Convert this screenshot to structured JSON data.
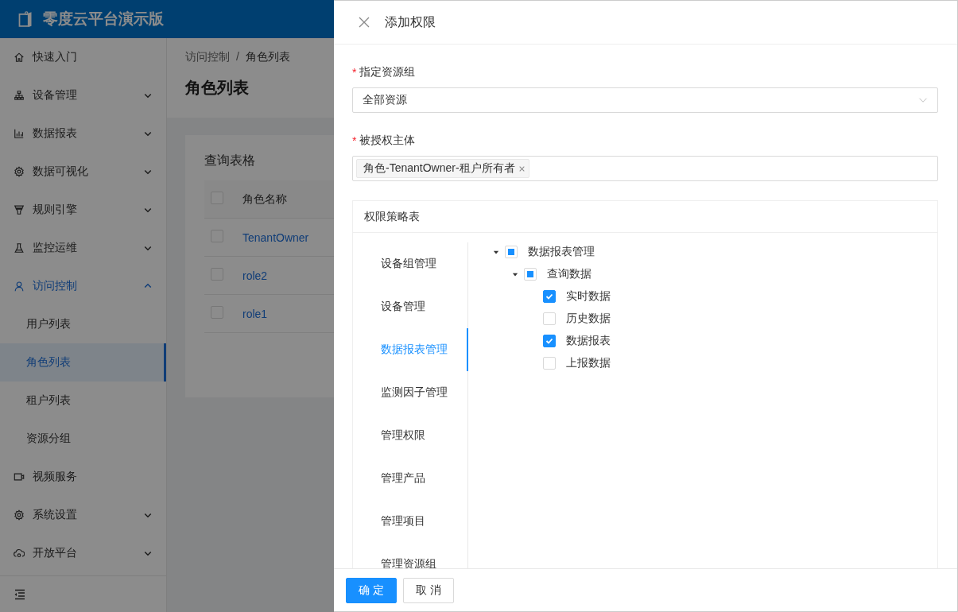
{
  "app": {
    "logo_text": "零度云平台演示版",
    "sidebar": {
      "items": [
        {
          "label": "快速入门",
          "kind": "link",
          "selected": false
        },
        {
          "label": "设备管理",
          "kind": "group",
          "expanded": false,
          "selected": false
        },
        {
          "label": "数据报表",
          "kind": "group",
          "expanded": false,
          "selected": false
        },
        {
          "label": "数据可视化",
          "kind": "group",
          "expanded": false,
          "selected": false
        },
        {
          "label": "规则引擎",
          "kind": "group",
          "expanded": false,
          "selected": false
        },
        {
          "label": "监控运维",
          "kind": "group",
          "expanded": false,
          "selected": false
        },
        {
          "label": "访问控制",
          "kind": "group",
          "expanded": true,
          "selected": true,
          "children": [
            {
              "label": "用户列表",
              "selected": false
            },
            {
              "label": "角色列表",
              "selected": true
            },
            {
              "label": "租户列表",
              "selected": false
            },
            {
              "label": "资源分组",
              "selected": false
            }
          ]
        },
        {
          "label": "视频服务",
          "kind": "link",
          "selected": false
        },
        {
          "label": "系统设置",
          "kind": "group",
          "expanded": false,
          "selected": false
        },
        {
          "label": "开放平台",
          "kind": "group",
          "expanded": false,
          "selected": false
        }
      ]
    },
    "breadcrumb": [
      "访问控制",
      "角色列表"
    ],
    "breadcrumb_separator": "/",
    "page_title": "角色列表",
    "card_title": "查询表格",
    "table": {
      "columns": [
        "角色名称"
      ],
      "all_checked": false,
      "rows": [
        {
          "cells": [
            "TenantOwner"
          ],
          "checked": false
        },
        {
          "cells": [
            "role2"
          ],
          "checked": false
        },
        {
          "cells": [
            "role1"
          ],
          "checked": false
        }
      ]
    }
  },
  "drawer": {
    "title": "添加权限",
    "fields": [
      {
        "label": "指定资源组",
        "required_mark": "*",
        "kind": "select",
        "value": "全部资源"
      },
      {
        "label": "被授权主体",
        "required_mark": "*",
        "kind": "tags",
        "tags": [
          "角色-TenantOwner-租户所有者"
        ]
      }
    ],
    "policy": {
      "title": "权限策略表",
      "categories": [
        {
          "label": "设备组管理",
          "selected": false
        },
        {
          "label": "设备管理",
          "selected": false
        },
        {
          "label": "数据报表管理",
          "selected": true
        },
        {
          "label": "监测因子管理",
          "selected": false
        },
        {
          "label": "管理权限",
          "selected": false
        },
        {
          "label": "管理产品",
          "selected": false
        },
        {
          "label": "管理项目",
          "selected": false
        },
        {
          "label": "管理资源组",
          "selected": false
        }
      ],
      "tree": [
        {
          "label": "数据报表管理",
          "expanded": true,
          "checked": false,
          "indeterminate": true,
          "children": [
            {
              "label": "查询数据",
              "expanded": true,
              "checked": false,
              "indeterminate": true,
              "children": [
                {
                  "label": "实时数据",
                  "checked": true
                },
                {
                  "label": "历史数据",
                  "checked": false
                },
                {
                  "label": "数据报表",
                  "checked": true
                },
                {
                  "label": "上报数据",
                  "checked": false
                }
              ]
            }
          ]
        }
      ]
    },
    "buttons": [
      {
        "label": "确 定",
        "kind": "primary"
      },
      {
        "label": "取 消",
        "kind": "default"
      }
    ]
  }
}
